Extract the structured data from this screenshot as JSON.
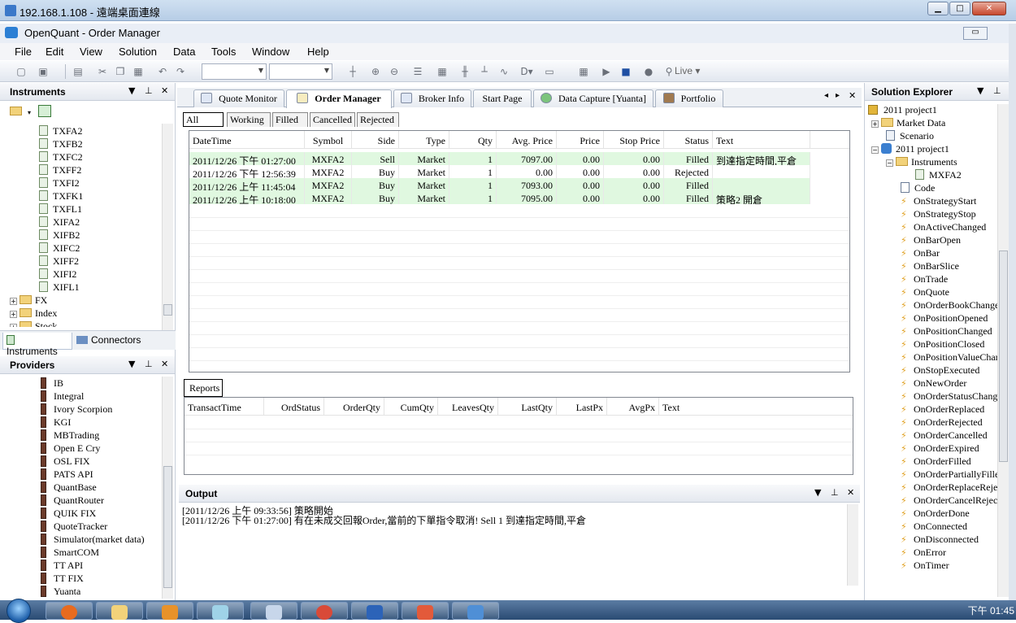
{
  "rdp": {
    "title": "192.168.1.108 - 遠端桌面連線",
    "min": "▁",
    "max": "□",
    "close": "✕"
  },
  "app": {
    "title": "OpenQuant - Order Manager",
    "mdi_min": "▭"
  },
  "menu": [
    "File",
    "Edit",
    "View",
    "Solution",
    "Data",
    "Tools",
    "Window",
    "Help"
  ],
  "toolbar": {
    "live": "Live",
    "d_label": "D"
  },
  "instruments": {
    "title": "Instruments",
    "items": [
      "TXFA2",
      "TXFB2",
      "TXFC2",
      "TXFF2",
      "TXFI2",
      "TXFK1",
      "TXFL1",
      "XIFA2",
      "XIFB2",
      "XIFC2",
      "XIFF2",
      "XIFI2",
      "XIFL1"
    ],
    "folders": [
      "FX",
      "Index",
      "Stock"
    ],
    "tabs": [
      "Instruments",
      "Connectors"
    ]
  },
  "providers": {
    "title": "Providers",
    "items": [
      "IB",
      "Integral",
      "Ivory Scorpion",
      "KGI",
      "MBTrading",
      "Open E Cry",
      "OSL FIX",
      "PATS API",
      "QuantBase",
      "QuantRouter",
      "QUIK FIX",
      "QuoteTracker",
      "Simulator(market data)",
      "SmartCOM",
      "TT API",
      "TT FIX",
      "Yuanta"
    ]
  },
  "doc_tabs": [
    "Quote Monitor",
    "Order Manager",
    "Broker Info",
    "Start Page",
    "Data Capture [Yuanta]",
    "Portfolio"
  ],
  "order_tabs": [
    "All",
    "Working",
    "Filled",
    "Cancelled",
    "Rejected"
  ],
  "orders": {
    "columns": [
      "DateTime",
      "Symbol",
      "Side",
      "Type",
      "Qty",
      "Avg. Price",
      "Price",
      "Stop Price",
      "Status",
      "Text"
    ],
    "rows": [
      [
        "2011/12/26 下午 01:27:00",
        "MXFA2",
        "Sell",
        "Market",
        "1",
        "7097.00",
        "0.00",
        "0.00",
        "Filled",
        "到達指定時間,平倉"
      ],
      [
        "2011/12/26 下午 12:56:39",
        "MXFA2",
        "Buy",
        "Market",
        "1",
        "0.00",
        "0.00",
        "0.00",
        "Rejected",
        ""
      ],
      [
        "2011/12/26 上午 11:45:04",
        "MXFA2",
        "Buy",
        "Market",
        "1",
        "7093.00",
        "0.00",
        "0.00",
        "Filled",
        ""
      ],
      [
        "2011/12/26 上午 10:18:00",
        "MXFA2",
        "Buy",
        "Market",
        "1",
        "7095.00",
        "0.00",
        "0.00",
        "Filled",
        "策略2 開倉"
      ]
    ]
  },
  "reports": {
    "tab": "Reports",
    "columns": [
      "TransactTime",
      "OrdStatus",
      "OrderQty",
      "CumQty",
      "LeavesQty",
      "LastQty",
      "LastPx",
      "AvgPx",
      "Text"
    ]
  },
  "output": {
    "title": "Output",
    "lines": [
      "[2011/12/26 上午 09:33:56] 策略開始",
      "[2011/12/26 下午 01:27:00] 有在未成交回報Order,當前的下單指令取消! Sell 1 到達指定時間,平倉"
    ]
  },
  "solution": {
    "title": "Solution Explorer",
    "project": "2011 project1",
    "market_data": "Market Data",
    "scenario": "Scenario",
    "strategy": "2011 project1",
    "instruments": "Instruments",
    "instrument": "MXFA2",
    "code": "Code",
    "events": [
      "OnStrategyStart",
      "OnStrategyStop",
      "OnActiveChanged",
      "OnBarOpen",
      "OnBar",
      "OnBarSlice",
      "OnTrade",
      "OnQuote",
      "OnOrderBookChange",
      "OnPositionOpened",
      "OnPositionChanged",
      "OnPositionClosed",
      "OnPositionValueChan",
      "OnStopExecuted",
      "OnNewOrder",
      "OnOrderStatusChang",
      "OnOrderReplaced",
      "OnOrderRejected",
      "OnOrderCancelled",
      "OnOrderExpired",
      "OnOrderFilled",
      "OnOrderPartiallyFille",
      "OnOrderReplaceReje",
      "OnOrderCancelReject",
      "OnOrderDone",
      "OnConnected",
      "OnDisconnected",
      "OnError",
      "OnTimer"
    ]
  },
  "taskbar": {
    "clock": "下午 01:45"
  }
}
